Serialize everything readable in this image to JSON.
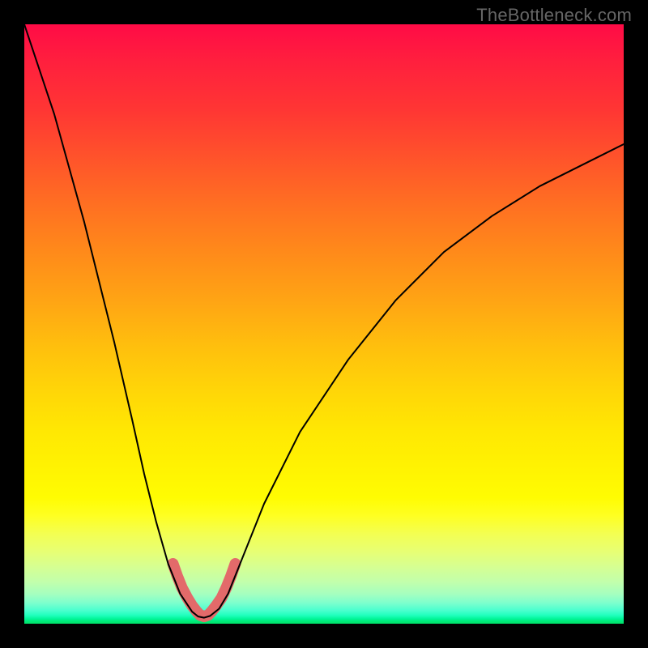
{
  "watermark": "TheBottleneck.com",
  "chart_data": {
    "type": "line",
    "title": "",
    "xlabel": "",
    "ylabel": "",
    "xlim": [
      0,
      100
    ],
    "ylim": [
      0,
      100
    ],
    "grid": false,
    "legend": false,
    "series": [
      {
        "name": "curve",
        "x": [
          0,
          5,
          10,
          15,
          18,
          20,
          22,
          24,
          26,
          28,
          29,
          30,
          31,
          32.5,
          34,
          36,
          40,
          46,
          54,
          62,
          70,
          78,
          86,
          94,
          100
        ],
        "values": [
          100,
          85,
          67,
          47,
          34,
          25,
          17,
          10,
          5,
          2,
          1.2,
          1,
          1.3,
          2.5,
          5,
          10,
          20,
          32,
          44,
          54,
          62,
          68,
          73,
          77,
          80
        ]
      }
    ],
    "highlight_zone": {
      "name": "optimal-zone",
      "x": [
        24.8,
        25.5,
        26.3,
        27.2,
        28,
        28.7,
        29.3,
        30,
        30.7,
        31.3,
        32,
        32.9,
        33.7,
        34.5,
        35.2
      ],
      "values": [
        10,
        8,
        6,
        4.3,
        3,
        2.1,
        1.45,
        1.2,
        1.45,
        2.1,
        3,
        4.3,
        6,
        8,
        10
      ]
    },
    "colors": {
      "curve": "#000000",
      "highlight": "#e36a6a",
      "gradient_top": "#ff0b46",
      "gradient_bottom": "#00e36a"
    }
  }
}
